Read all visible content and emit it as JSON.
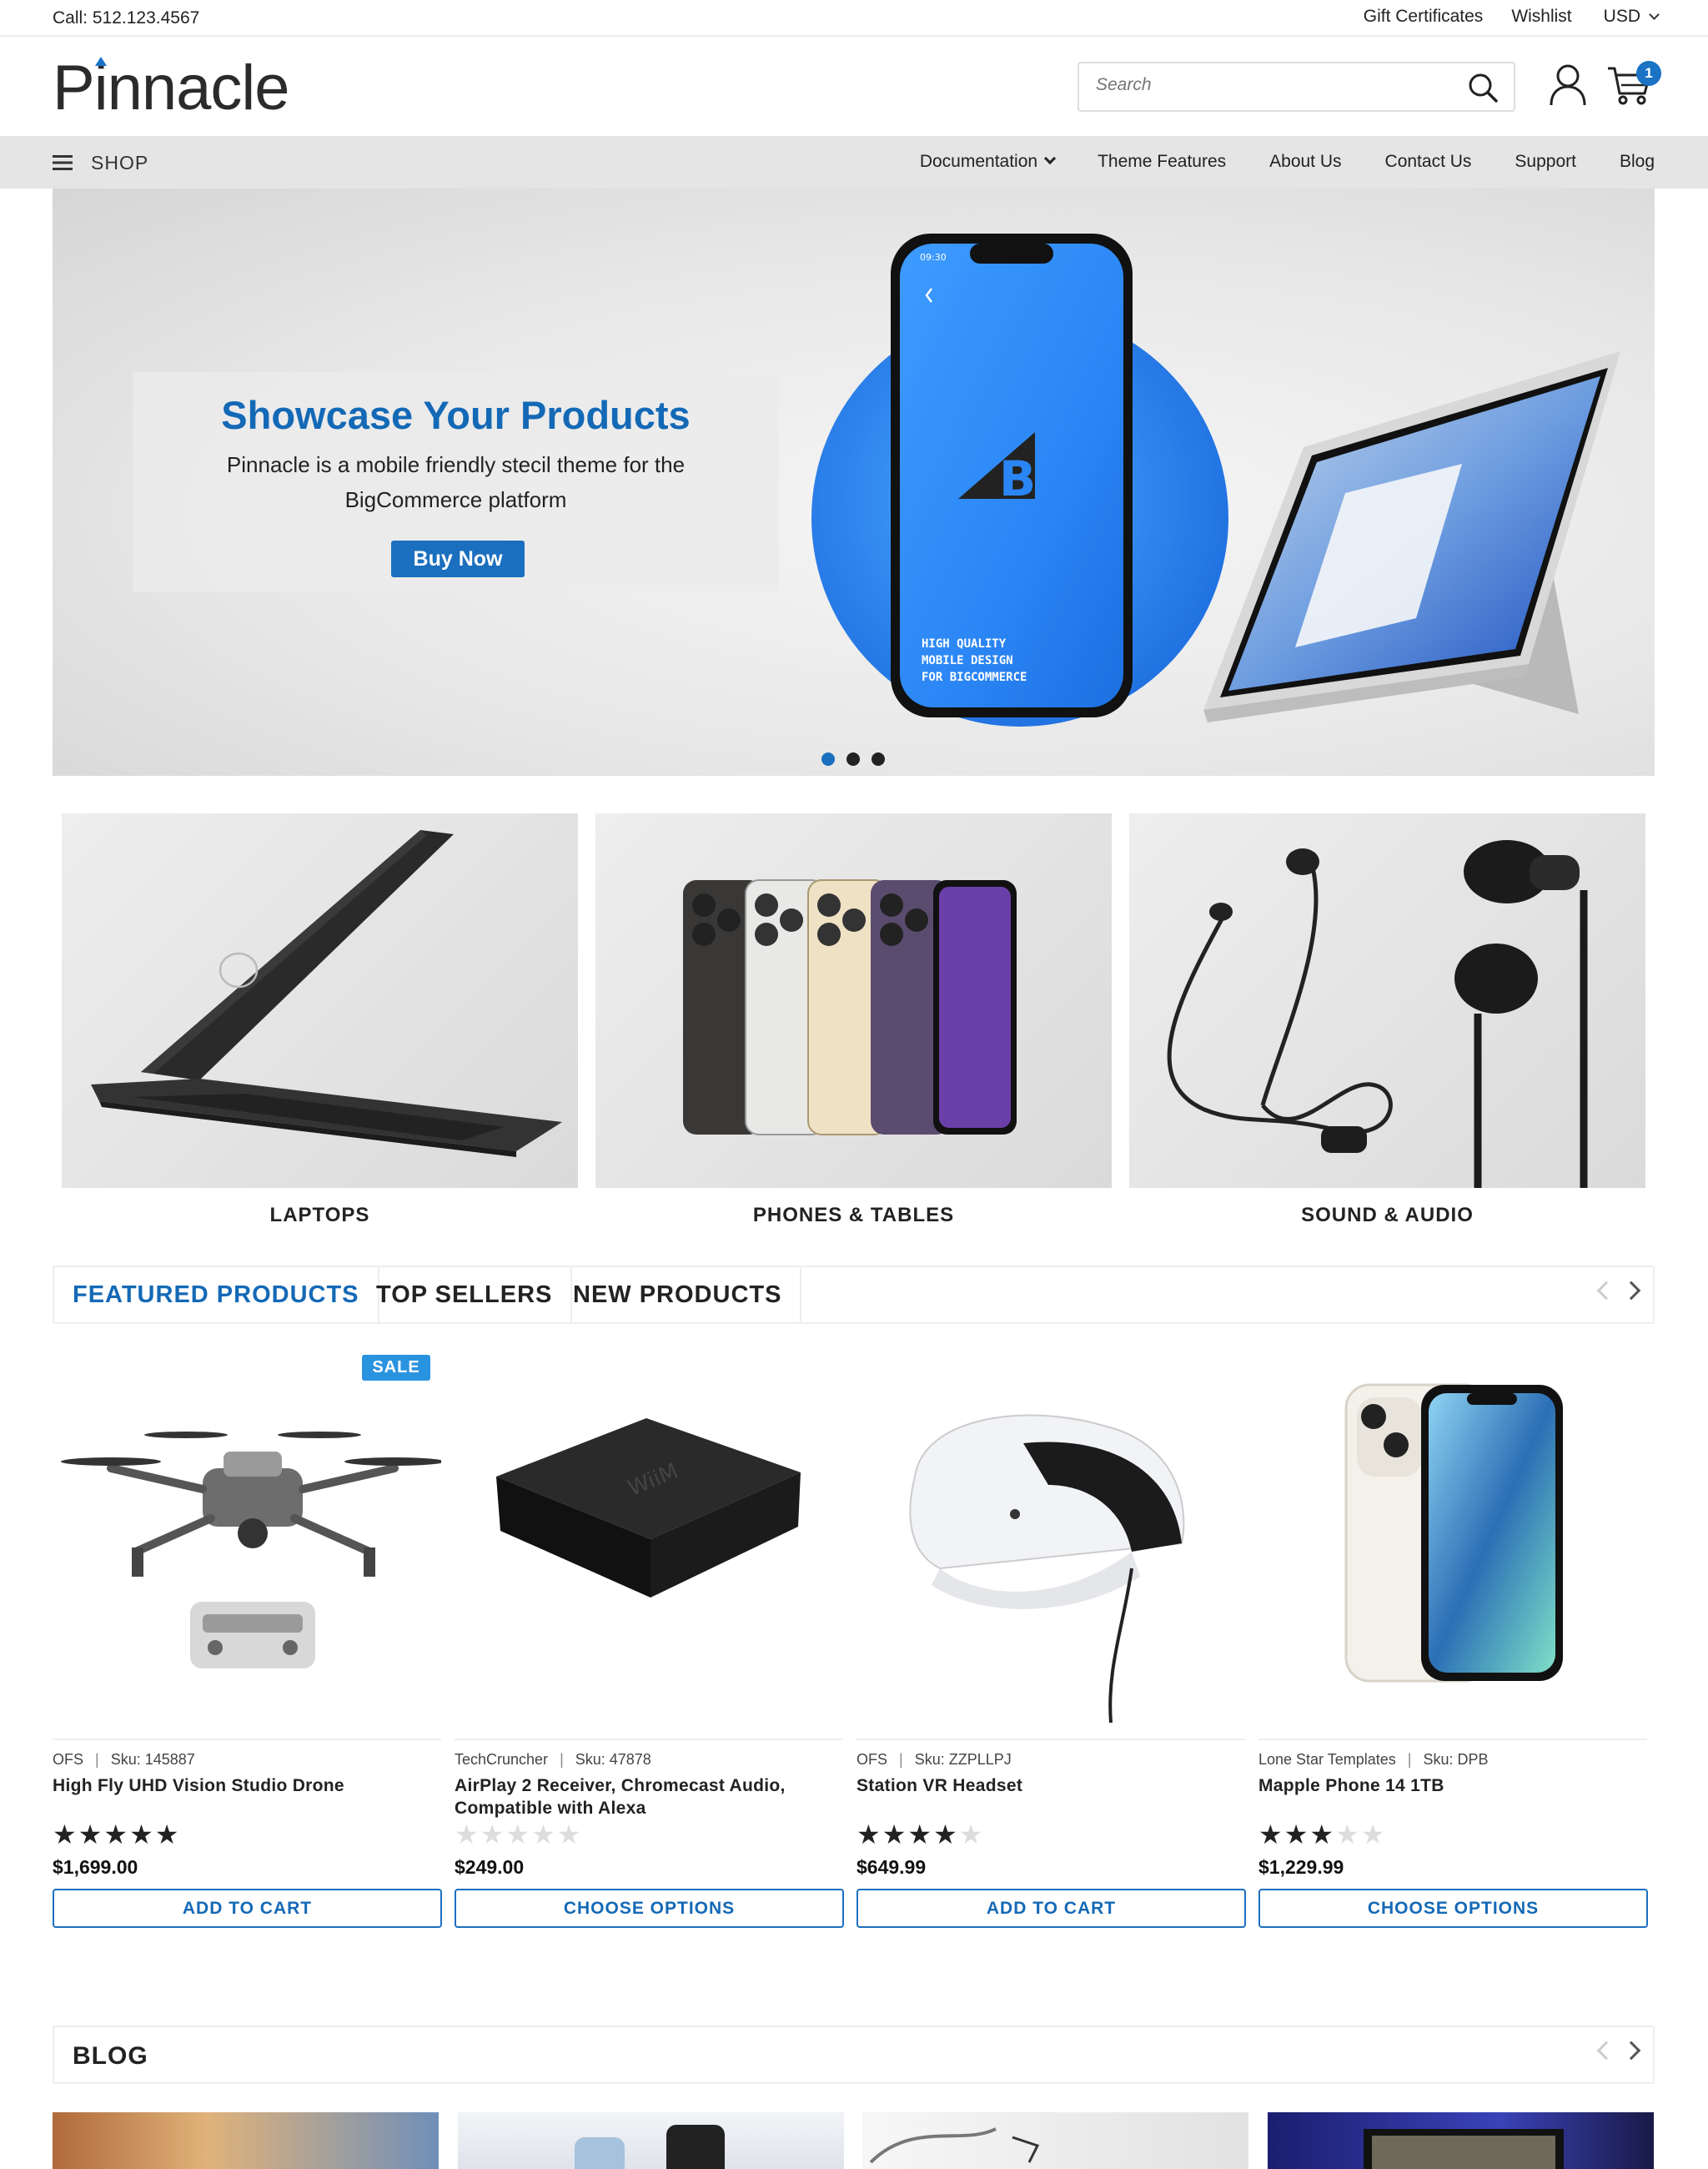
{
  "topbar": {
    "call": "Call: 512.123.4567",
    "links": [
      "Gift Certificates",
      "Wishlist"
    ],
    "currency": "USD"
  },
  "header": {
    "logo": "Pinnacle",
    "search_placeholder": "Search",
    "cart_count": "1"
  },
  "nav": {
    "shop_label": "SHOP",
    "items": [
      "Documentation",
      "Theme Features",
      "About Us",
      "Contact Us",
      "Support",
      "Blog"
    ]
  },
  "hero": {
    "title": "Showcase Your Products",
    "subtitle": "Pinnacle is a mobile friendly stecil theme for the BigCommerce platform",
    "button": "Buy Now",
    "phone_text": "HIGH QUALITY MOBILE DESIGN FOR BIGCOMMERCE",
    "slide_count": 3,
    "active_slide": 1
  },
  "categories": [
    {
      "label": "LAPTOPS"
    },
    {
      "label": "PHONES & TABLES"
    },
    {
      "label": "SOUND & AUDIO"
    }
  ],
  "tabs": [
    "FEATURED PRODUCTS",
    "TOP SELLERS",
    "NEW PRODUCTS"
  ],
  "products": [
    {
      "brand": "OFS",
      "sku": "Sku: 145887",
      "name": "High Fly UHD Vision Studio Drone",
      "rating": 5,
      "price": "$1,699.00",
      "button": "ADD TO CART",
      "badge": "SALE"
    },
    {
      "brand": "TechCruncher",
      "sku": "Sku: 47878",
      "name": "AirPlay 2 Receiver, Chromecast Audio, Compatible with Alexa",
      "rating": 0,
      "price": "$249.00",
      "button": "CHOOSE OPTIONS"
    },
    {
      "brand": "OFS",
      "sku": "Sku: ZZPLLPJ",
      "name": "Station VR Headset",
      "rating": 4,
      "price": "$649.99",
      "button": "ADD TO CART"
    },
    {
      "brand": "Lone Star Templates",
      "sku": "Sku: DPB",
      "name": "Mapple Phone 14 1TB",
      "rating": 3,
      "price": "$1,229.99",
      "button": "CHOOSE OPTIONS"
    }
  ],
  "blog": {
    "title": "BLOG"
  },
  "colors": {
    "accent": "#1b6fbf",
    "nav_bg": "#e5e5e5"
  }
}
